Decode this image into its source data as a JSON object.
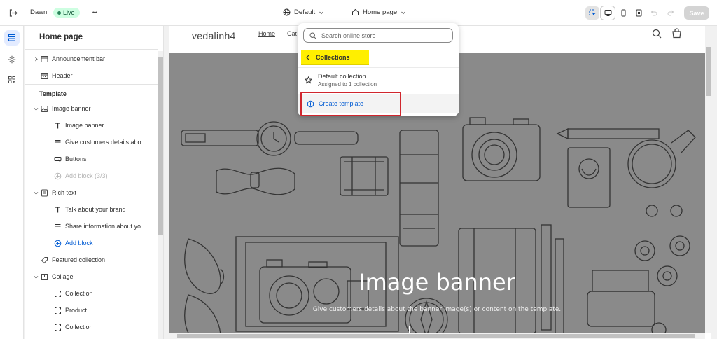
{
  "topbar": {
    "theme_name": "Dawn",
    "live_label": "Live",
    "more_label": "•••",
    "template_selector": "Default",
    "page_selector": "Home page",
    "save_label": "Save"
  },
  "sidebar": {
    "title": "Home page",
    "announcement": "Announcement bar",
    "header": "Header",
    "template_section": "Template",
    "items": [
      {
        "label": "Image banner"
      },
      {
        "label": "Image banner"
      },
      {
        "label": "Give customers details abo..."
      },
      {
        "label": "Buttons"
      },
      {
        "label": "Add block (3/3)"
      },
      {
        "label": "Rich text"
      },
      {
        "label": "Talk about your brand"
      },
      {
        "label": "Share information about yo..."
      },
      {
        "label": "Add block"
      },
      {
        "label": "Featured collection"
      },
      {
        "label": "Collage"
      },
      {
        "label": "Collection"
      },
      {
        "label": "Product"
      },
      {
        "label": "Collection"
      }
    ]
  },
  "preview": {
    "store_name": "vedalinh4",
    "nav": [
      "Home",
      "Cat"
    ],
    "banner_title": "Image banner",
    "banner_subtitle": "Give customers details about the banner image(s) or content on the template."
  },
  "dropdown": {
    "search_placeholder": "Search online store",
    "back_label": "Collections",
    "item_title": "Default collection",
    "item_subtitle": "Assigned to 1 collection",
    "create_label": "Create template"
  },
  "colors": {
    "accent": "#005bd3",
    "highlight": "#ffef00",
    "annotation": "#d0262d",
    "live_bg": "#cdfee1"
  }
}
